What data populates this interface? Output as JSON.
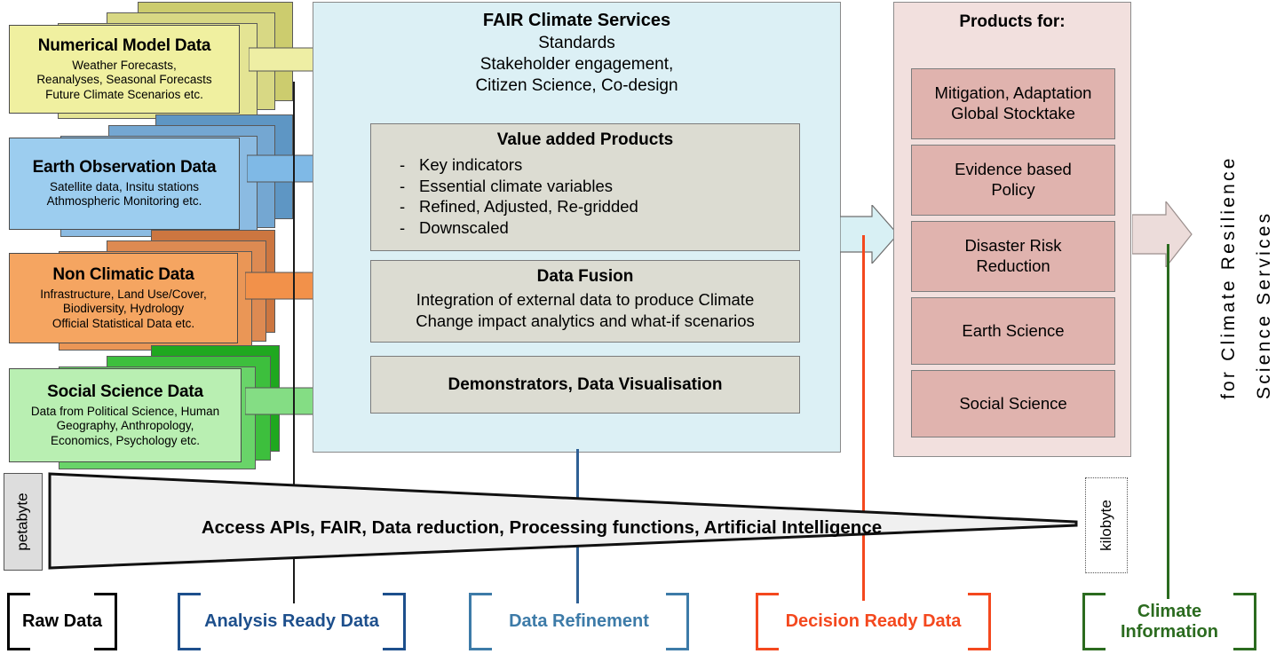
{
  "sources": [
    {
      "title": "Numerical Model Data",
      "subtitle": "Weather Forecasts,\nReanalyses, Seasonal Forecasts\nFuture Climate Scenarios etc.",
      "fill": "#f0f0a0",
      "stack_fill": "#cccc6e",
      "arrow_fill": "#eeeea4"
    },
    {
      "title": "Earth Observation Data",
      "subtitle": "Satellite data, Insitu stations\nAthmospheric Monitoring etc.",
      "fill": "#9ccdef",
      "stack_fill": "#5e96c4",
      "arrow_fill": "#7fb9e6"
    },
    {
      "title": "Non Climatic Data",
      "subtitle": "Infrastructure, Land Use/Cover,\nBiodiversity, Hydrology\nOfficial Statistical Data etc.",
      "fill": "#f5a561",
      "stack_fill": "#cc7640",
      "arrow_fill": "#f2914a"
    },
    {
      "title": "Social Science Data",
      "subtitle": "Data from Political Science, Human\nGeography, Anthropology,\nEconomics, Psychology etc.",
      "fill": "#b9efb2",
      "stack_fill": "#1fa81f",
      "arrow_fill": "#84dd84"
    }
  ],
  "center": {
    "heading": "FAIR Climate Services",
    "lines": [
      "Standards",
      "Stakeholder engagement,",
      "Citizen Science, Co-design"
    ],
    "boxes": [
      {
        "title": "Value added Products",
        "bullets": [
          "Key indicators",
          "Essential climate variables",
          "Refined, Adjusted, Re-gridded",
          "Downscaled"
        ],
        "lines": []
      },
      {
        "title": "Data Fusion",
        "bullets": [],
        "lines": [
          "Integration of external data to produce Climate",
          "Change impact analytics and what-if scenarios"
        ]
      },
      {
        "title": "Demonstrators, Data Visualisation",
        "bullets": [],
        "lines": []
      }
    ]
  },
  "products": {
    "heading": "Products for:",
    "items": [
      "Mitigation, Adaptation\nGlobal Stocktake",
      "Evidence based\nPolicy",
      "Disaster Risk\nReduction",
      "Earth Science",
      "Social Science"
    ]
  },
  "vertical_label": {
    "line1": "Science Services",
    "line2": "for Climate Resilience"
  },
  "funnel": {
    "text": "Access APIs, FAIR, Data reduction, Processing functions, Artificial Intelligence",
    "left_size": "petabyte",
    "right_size": "kilobyte",
    "fill": "#f0f0f0"
  },
  "stage_labels": [
    {
      "text": "Raw Data",
      "color": "#000000"
    },
    {
      "text": "Analysis Ready Data",
      "color": "#1d4f8c"
    },
    {
      "text": "Data Refinement",
      "color": "#3d7ba8"
    },
    {
      "text": "Decision Ready Data",
      "color": "#f4481e"
    },
    {
      "text": "Climate\nInformation",
      "color": "#2b6b1f"
    }
  ],
  "colors": {
    "center_panel": "#dcf0f5",
    "grey_box": "#dcdcd2",
    "products_panel": "#f2e0de",
    "product_item": "#e0b3ae",
    "center_arrow": "#d8f0f4",
    "final_arrow": "#ecdcda"
  }
}
